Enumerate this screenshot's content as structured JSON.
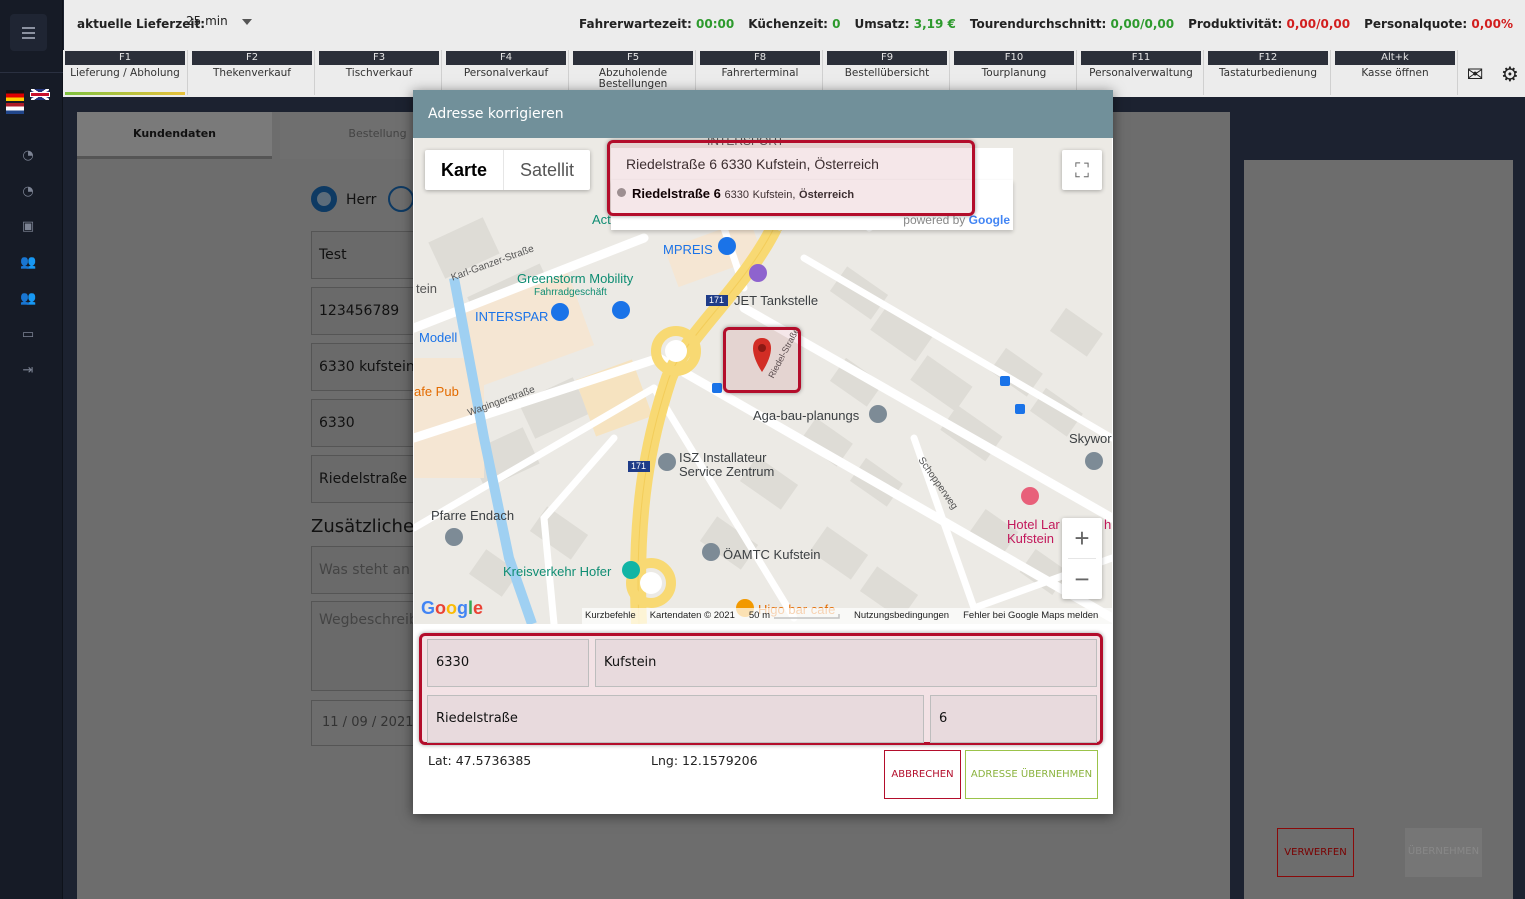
{
  "sidebar": {
    "icons": [
      "menu-icon",
      "dashboard-icon",
      "speed-icon",
      "store-icon",
      "users-icon",
      "staff-icon",
      "monitor-icon",
      "logout-icon"
    ]
  },
  "topbar": {
    "lieferzeit_label": "aktuelle Lieferzeit:",
    "lieferzeit_value": "25 min",
    "stats": [
      {
        "label": "Fahrerwartezeit:",
        "value": "00:00",
        "color": "#2d9a2d"
      },
      {
        "label": "Küchenzeit:",
        "value": "0",
        "color": "#2d9a2d"
      },
      {
        "label": "Umsatz:",
        "value": "3,19 €",
        "color": "#2d9a2d"
      },
      {
        "label": "Tourendurchschnitt:",
        "value": "0,00/0,00",
        "color": "#2d9a2d"
      },
      {
        "label": "Produktivität:",
        "value": "0,00/0,00",
        "color": "#d21e1e"
      },
      {
        "label": "Personalquote:",
        "value": "0,00%",
        "color": "#d21e1e"
      }
    ]
  },
  "fkeys": [
    {
      "key": "F1",
      "label": "Lieferung / Abholung"
    },
    {
      "key": "F2",
      "label": "Thekenverkauf"
    },
    {
      "key": "F3",
      "label": "Tischverkauf"
    },
    {
      "key": "F4",
      "label": "Personalverkauf"
    },
    {
      "key": "F5",
      "label": "Abzuholende Bestellungen"
    },
    {
      "key": "F8",
      "label": "Fahrerterminal"
    },
    {
      "key": "F9",
      "label": "Bestellübersicht"
    },
    {
      "key": "F10",
      "label": "Tourplanung"
    },
    {
      "key": "F11",
      "label": "Personalverwaltung"
    },
    {
      "key": "F12",
      "label": "Tastaturbedienung"
    },
    {
      "key": "Alt+k",
      "label": "Kasse öffnen"
    }
  ],
  "background": {
    "tab_kundendaten": "Kundendaten",
    "tab_bestellung": "Bestellung",
    "salutation": "Herr",
    "field_name": "Test",
    "field_phone": "123456789",
    "field_city_search": "6330 kufstein",
    "field_zip": "6330",
    "field_street": "Riedelstraße",
    "heading_extra": "Zusätzliche I",
    "placeholder_note": "Was steht an d",
    "placeholder_directions": "Wegbeschreibu",
    "date_day": "11",
    "date_month": "09",
    "date_year": "2021",
    "btn_verwerfen": "VERWERFEN",
    "btn_uebernehmen": "ÜBERNEHMEN"
  },
  "modal": {
    "title": "Adresse korrigieren",
    "map": {
      "type_map": "Karte",
      "type_satellite": "Satellit",
      "search_value": "Riedelstraße 6 6330 Kufstein, Österreich",
      "suggestion_main": "Riedelstraße 6",
      "suggestion_zip": "6330",
      "suggestion_city": "Kufstein,",
      "suggestion_country": "Österreich",
      "powered_by": "powered by",
      "google": "Google",
      "labels": {
        "intersport": "INTERSPORT",
        "act": "Act",
        "mpreis": "MPREIS",
        "greenstorm": "Greenstorm Mobility",
        "fahrradgeschaeft": "Fahrradgeschäft",
        "karl_ganzer": "Karl-Ganzer-Straße",
        "tein": "tein",
        "jet": "JET Tankstelle",
        "interspar": "INTERSPAR",
        "modell": "Modell",
        "cafe_pub": "afe Pub",
        "waginger": "Wagingerstraße",
        "riedel": "Riedel-Straße",
        "aga": "Aga-bau-planungs",
        "skywo": "Skywor",
        "isz1": "ISZ Installateur",
        "isz2": "Service Zentrum",
        "schopperweg": "Schopperweg",
        "hotel1": "Hotel Lar",
        "hotel2": "Kufstein",
        "hotel_h": "h",
        "pfarre": "Pfarre Endach",
        "oeamtc": "ÖAMTC Kufstein",
        "kreisverkehr": "Kreisverkehr Hofer",
        "higo": "Higo bar cafe",
        "road171a": "171",
        "road171b": "171"
      },
      "footer": {
        "shortcuts": "Kurzbefehle",
        "mapdata": "Kartendaten © 2021",
        "scale": "50 m",
        "terms": "Nutzungsbedingungen",
        "report": "Fehler bei Google Maps melden"
      }
    },
    "form": {
      "zip": "6330",
      "city": "Kufstein",
      "street": "Riedelstraße",
      "number": "6"
    },
    "lat_label": "Lat: 47.5736385",
    "lng_label": "Lng: 12.1579206",
    "btn_cancel": "ABBRECHEN",
    "btn_confirm": "ADRESSE ÜBERNEHMEN"
  }
}
